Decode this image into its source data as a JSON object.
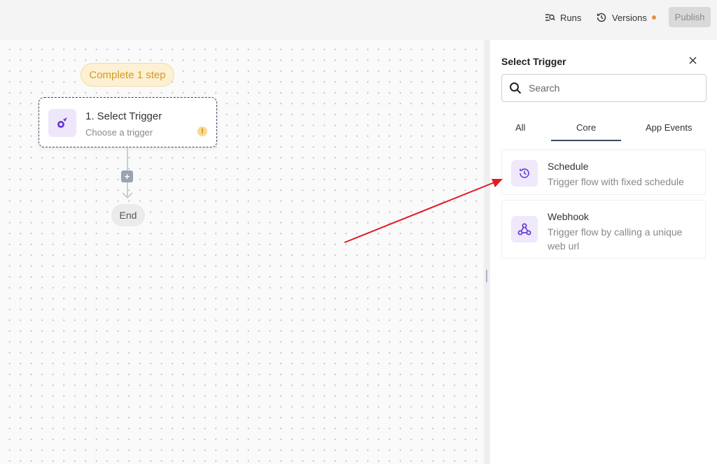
{
  "topbar": {
    "runs_label": "Runs",
    "versions_label": "Versions",
    "publish_label": "Publish",
    "runs_icon": "list-search-icon",
    "versions_icon": "history-icon",
    "version_dot_color": "#e0933a"
  },
  "canvas": {
    "status_pill": "Complete 1 step",
    "step": {
      "title": "1. Select Trigger",
      "subtitle": "Choose a trigger",
      "icon": "trigger-icon",
      "warning": "!"
    },
    "add_button": "+",
    "end_label": "End"
  },
  "panel": {
    "title": "Select Trigger",
    "search_placeholder": "Search",
    "tabs": [
      {
        "label": "All",
        "active": false
      },
      {
        "label": "Core",
        "active": true
      },
      {
        "label": "App Events",
        "active": false
      }
    ],
    "triggers": [
      {
        "name": "Schedule",
        "description": "Trigger flow with fixed schedule",
        "icon": "clock-icon"
      },
      {
        "name": "Webhook",
        "description": "Trigger flow by calling a unique web url",
        "icon": "webhook-icon"
      }
    ]
  },
  "colors": {
    "accent_purple": "#6a3cd6",
    "pill_text": "#d39b23",
    "annotation_arrow": "#e01b24"
  }
}
